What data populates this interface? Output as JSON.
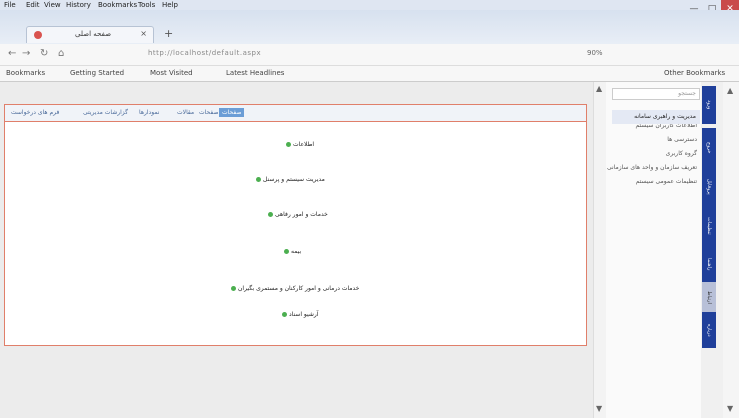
{
  "menubar": {
    "items": [
      "File",
      "Edit",
      "View",
      "History",
      "Bookmarks",
      "Tools",
      "Help"
    ]
  },
  "window": {
    "minimize": "—",
    "maximize": "□",
    "close": "✕"
  },
  "tab": {
    "title": "صفحه اصلی",
    "close": "×",
    "new": "+"
  },
  "nav": {
    "back": "←",
    "forward": "→",
    "reload": "↻",
    "home": "⌂",
    "url": "http://localhost/default.aspx",
    "zoom": "90%",
    "icons": [
      "back-icon",
      "forward-icon",
      "reload-icon",
      "home-icon"
    ]
  },
  "bookmarks": {
    "items": [
      "Bookmarks",
      "Getting Started",
      "Most Visited",
      "Latest Headlines"
    ],
    "right": "Other Bookmarks"
  },
  "content_tabs": [
    "صفحات",
    "صفحات",
    "مقالات",
    "نمودارها",
    "گزارشات مدیریتی",
    "فرم های درخواست"
  ],
  "tree": [
    {
      "label": "اطلاعات"
    },
    {
      "label": "مدیریت سیستم و پرسنل"
    },
    {
      "label": "خدمات و امور رفاهی"
    },
    {
      "label": "بیمه"
    },
    {
      "label": "خدمات درمانی و امور کارکنان و مستمری بگیران"
    },
    {
      "label": "آرشیو اسناد"
    }
  ],
  "sidepanel": {
    "search": "جستجو",
    "highlight": "مدیریت و راهبری سامانه",
    "items": [
      "اطلاعات کاربران سیستم",
      "دسترسی ها",
      "گروه کاربری",
      "تعریف سازمان و واحد های سازمانی",
      "تنظیمات عمومی سیستم"
    ]
  },
  "rail": [
    "ورود",
    "خروج",
    "پروفایل",
    "تنظیمات",
    "راهنما",
    "ارتباط",
    "درباره"
  ],
  "scroll": {
    "up": "▲",
    "down": "▼"
  }
}
